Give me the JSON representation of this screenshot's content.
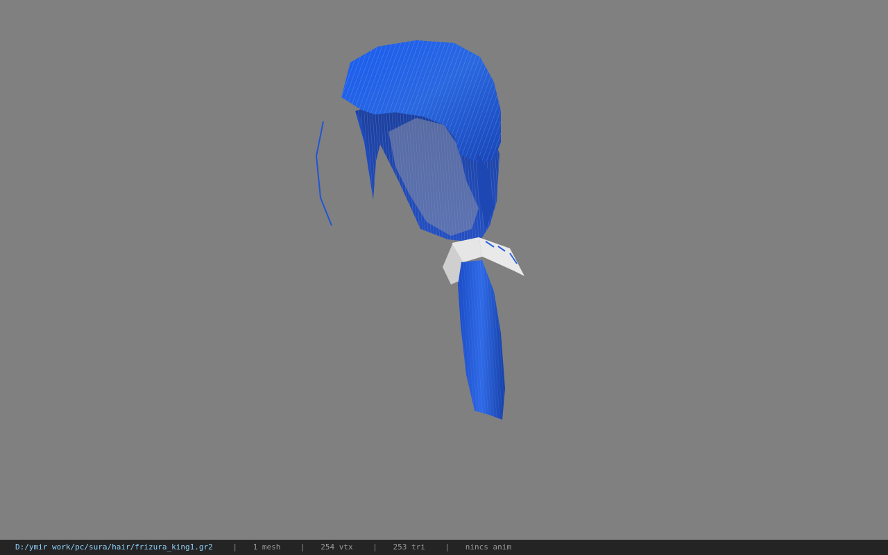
{
  "app": {
    "background_color": "#808080"
  },
  "model": {
    "hair_color": "#1f55d6",
    "hair_dark_color": "#123a9a",
    "ribbon_color": "#e6e6e6"
  },
  "status_bar": {
    "file_path": "D:/ymir work/pc/sura/hair/frizura_king1.gr2",
    "separator": "|",
    "mesh_count": "1 mesh",
    "vertex_count": "254 vtx",
    "triangle_count": "253 tri",
    "anim_status": "nincs anim",
    "path_color": "#8fd3ff",
    "bar_color": "#242424"
  }
}
